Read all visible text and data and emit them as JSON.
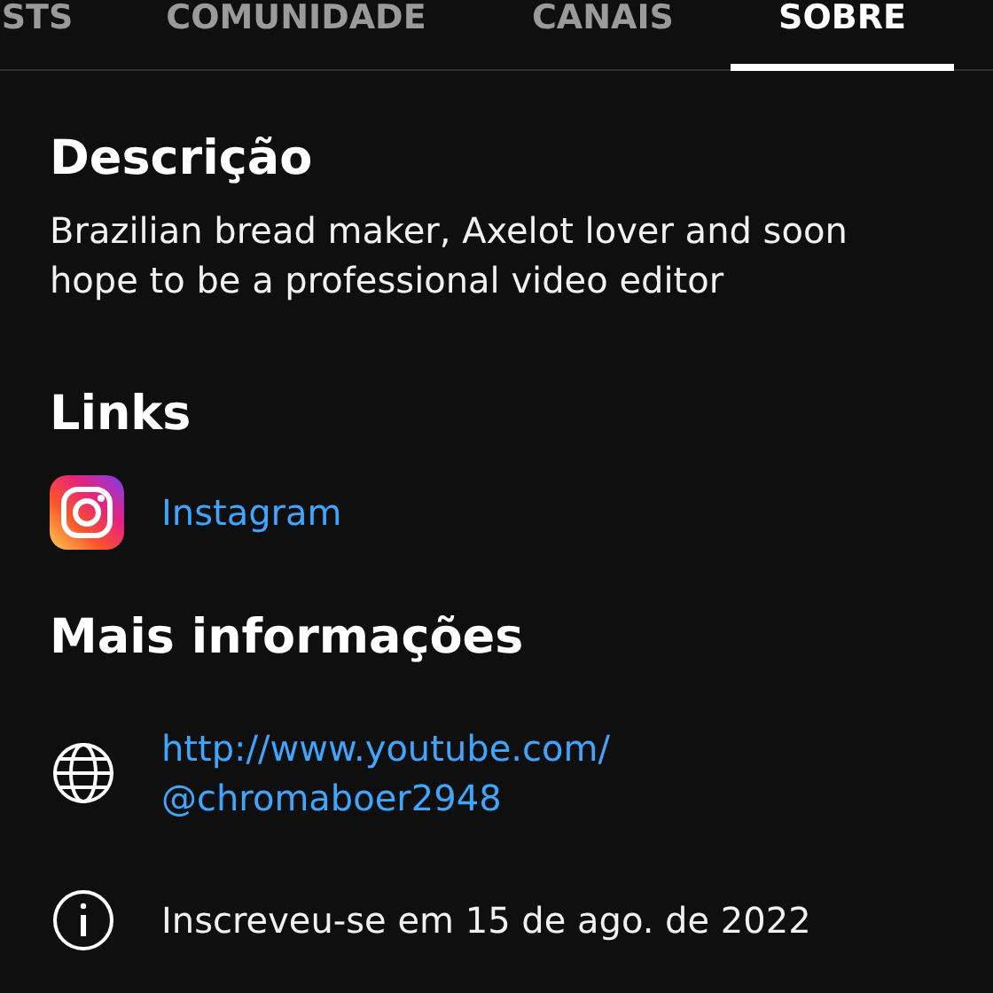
{
  "tabs": [
    {
      "label": "STS",
      "selected": false
    },
    {
      "label": "COMUNIDADE",
      "selected": false
    },
    {
      "label": "CANAIS",
      "selected": false
    },
    {
      "label": "SOBRE",
      "selected": true
    }
  ],
  "description": {
    "heading": "Descrição",
    "text": "Brazilian bread maker, Axelot lover and soon hope to be a professional video editor"
  },
  "links": {
    "heading": "Links",
    "items": [
      {
        "label": "Instagram"
      }
    ]
  },
  "more_info": {
    "heading": "Mais informações",
    "items": [
      {
        "kind": "link",
        "lines": [
          "http://www.youtube.com/",
          "@chromaboer2948"
        ]
      },
      {
        "kind": "info",
        "lines": [
          "Inscreveu-se em 15 de ago. de 2022"
        ]
      }
    ]
  }
}
